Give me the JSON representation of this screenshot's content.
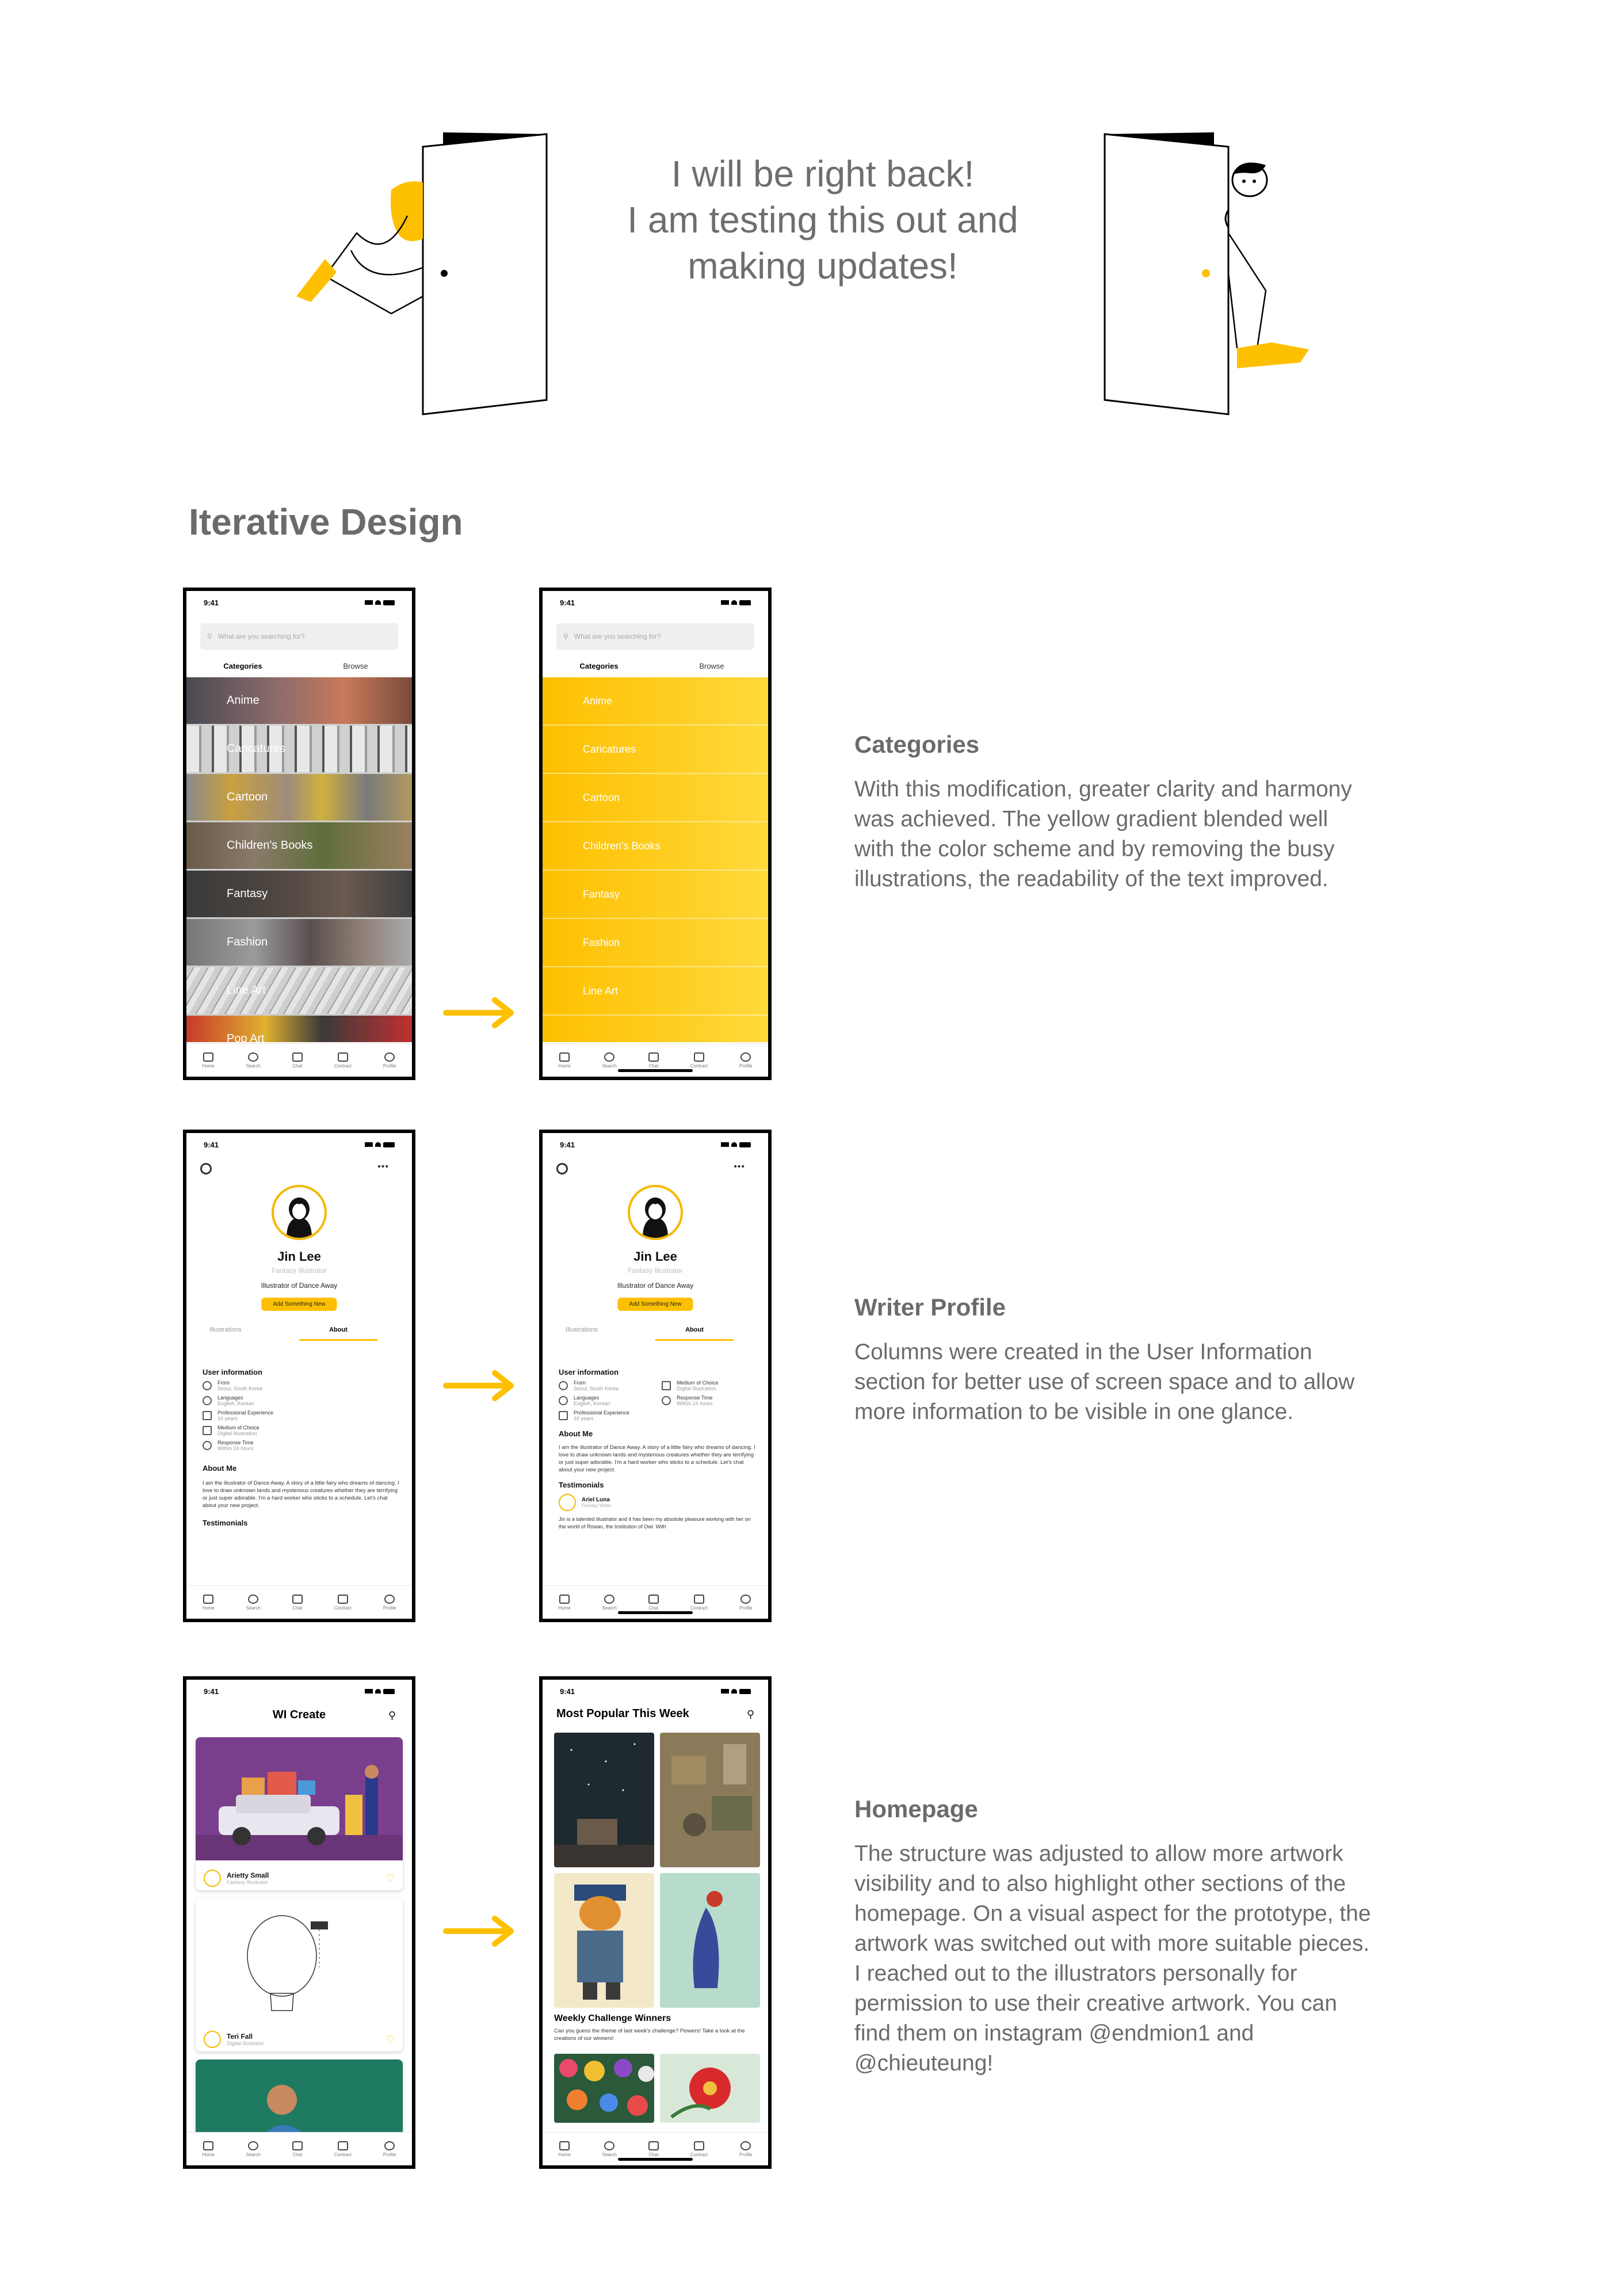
{
  "banner": {
    "line1": "I will be right back!",
    "line2": "I am testing this out and",
    "line3": "making updates!"
  },
  "section_title": "Iterative Design",
  "colors": {
    "accent": "#fdc000",
    "text": "#6b6b6b"
  },
  "status_time": "9:41",
  "categories": {
    "heading": "Categories",
    "body": "With this modification, greater clarity and harmony was achieved. The yellow gradient blended well with the color scheme and by removing the busy illustrations, the readability of the text improved.",
    "search_placeholder": "What are you searching for?",
    "tab_categories": "Categories",
    "tab_browse": "Browse",
    "items": [
      "Anime",
      "Caricatures",
      "Cartoon",
      "Children's Books",
      "Fantasy",
      "Fashion",
      "Line Art",
      "Pop Art"
    ]
  },
  "nav": {
    "home": "Home",
    "search": "Search",
    "chat": "Chat",
    "contract": "Contract",
    "profile": "Profile"
  },
  "profile": {
    "heading": "Writer Profile",
    "body": "Columns were created in the User Information section for better use of screen space and to allow more information to be visible in one glance.",
    "name": "Jin Lee",
    "role": "Fantasy Illustrator",
    "bio": "Illustrator of Dance Away",
    "button": "Add Something New",
    "tab_illustrations": "Illustrations",
    "tab_about": "About",
    "user_info": "User information",
    "from_label": "From",
    "from_value": "Seoul, South Korea",
    "languages_label": "Languages",
    "languages_value": "English, Korean",
    "experience_label": "Professional Experience",
    "experience_value": "10 years",
    "medium_label": "Medium of Choice",
    "medium_value": "Digital Illustration",
    "response_label": "Response Time",
    "response_value": "Within 24 hours",
    "about_me": "About Me",
    "about_text": "I am the illustrator of Dance Away. A story of a little fairy who dreams of dancing. I love to draw unknown lands and mysterious creatures whether they are terrifying or just super adorable. I'm a hard worker who sticks to a schedule. Let's chat about your new project.",
    "testimonials": "Testimonials",
    "testimonial_name": "Ariel Luna",
    "testimonial_role": "Fantasy Writer",
    "testimonial_text": "Jin is a talented illustrator and it has been my absolute pleasure working with her on the world of Rowan, the Institution of Owl. With"
  },
  "homepage": {
    "heading": "Homepage",
    "body": "The structure was adjusted to allow more artwork visibility and to also highlight other sections of the homepage. On a visual aspect for the prototype, the artwork was switched out with more suitable pieces. I reached out to the illustrators personally for permission to use their creative artwork. You can find them on instagram @endmion1 and @chieuteung!",
    "old_title": "WI Create",
    "card1_name": "Arietty Small",
    "card1_sub": "Fantasy Illustrator",
    "card2_name": "Teri Fall",
    "card2_sub": "Digital Illustrator",
    "new_title": "Most Popular This Week",
    "weekly_title": "Weekly Challenge Winners",
    "weekly_text": "Can you guess the theme of last week's challenge? Flowers! Take a look at the creations of our winners!"
  }
}
